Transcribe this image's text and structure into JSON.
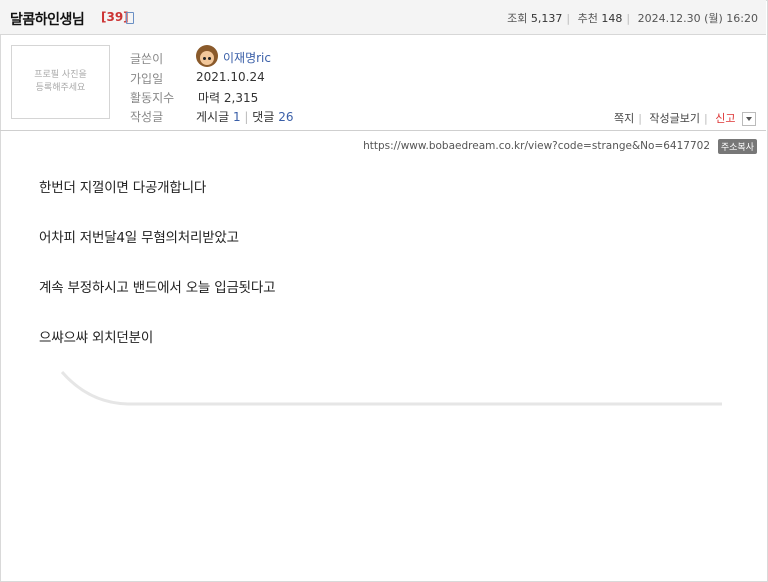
{
  "header": {
    "title": "달콤하인생님",
    "count": "[39]",
    "views_label": "조회",
    "views": "5,137",
    "recommend_label": "추천",
    "recommend": "148",
    "date": "2024.12.30 (월) 16:20"
  },
  "profile": {
    "photo_placeholder_line1": "프로필 사진을",
    "photo_placeholder_line2": "등록해주세요",
    "author_label": "글쓴이",
    "author": "이재명ric",
    "joined_label": "가입일",
    "joined": "2021.10.24",
    "activity_label": "활동지수",
    "activity_prefix": "마력",
    "activity_value": "2,315",
    "posts_label": "작성글",
    "posts_text": "게시글",
    "posts_count": "1",
    "comments_text": "댓글",
    "comments_count": "26"
  },
  "actions": {
    "message": "쪽지",
    "view_posts": "작성글보기",
    "report": "신고"
  },
  "url": {
    "text": "https://www.bobaedream.co.kr/view?code=strange&No=6417702",
    "copy_label": "주소복사"
  },
  "body": {
    "lines": [
      "한번더 지껄이면 다공개합니다",
      "어차피 저번달4일 무혐의처리받았고",
      "계속 부정하시고 밴드에서 오늘 입금됫다고",
      "으쌰으쌰 외치던분이"
    ]
  }
}
